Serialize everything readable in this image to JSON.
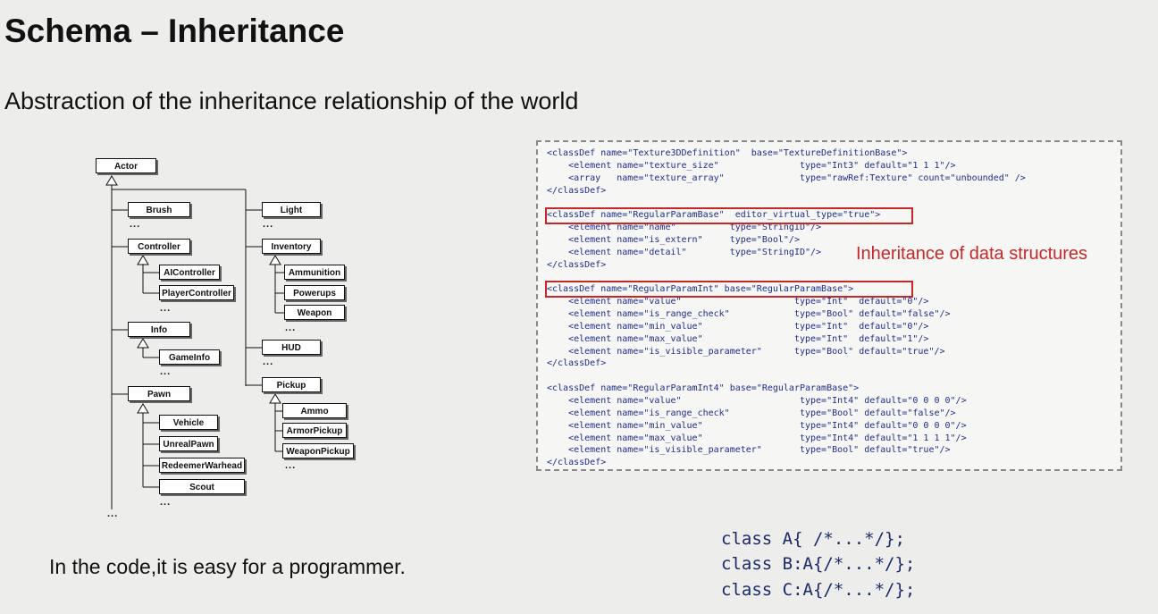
{
  "slide": {
    "title": "Schema – Inheritance",
    "subtitle": "Abstraction of the inheritance relationship of the world",
    "bottom_note": "In the code,it is easy for a programmer."
  },
  "tree": {
    "root": "Actor",
    "nodes": [
      "Brush",
      "Controller",
      "AIController",
      "PlayerController",
      "Info",
      "GameInfo",
      "Pawn",
      "Vehicle",
      "UnrealPawn",
      "RedeemerWarhead",
      "Scout",
      "Light",
      "Inventory",
      "Ammunition",
      "Powerups",
      "Weapon",
      "HUD",
      "Pickup",
      "Ammo",
      "ArmorPickup",
      "WeaponPickup"
    ],
    "ellipsis": "..."
  },
  "xml": {
    "annotation": "Inheritance of data structures",
    "lines": [
      "<classDef name=\"Texture3DDefinition\"  base=\"TextureDefinitionBase\">",
      "    <element name=\"texture_size\"               type=\"Int3\" default=\"1 1 1\"/>",
      "    <array   name=\"texture_array\"              type=\"rawRef:Texture\" count=\"unbounded\" />",
      "</classDef>",
      "",
      "<classDef name=\"RegularParamBase\"  editor_virtual_type=\"true\">",
      "    <element name=\"name\"          type=\"StringID\"/>",
      "    <element name=\"is_extern\"     type=\"Bool\"/>",
      "    <element name=\"detail\"        type=\"StringID\"/>",
      "</classDef>",
      "",
      "<classDef name=\"RegularParamInt\" base=\"RegularParamBase\">",
      "    <element name=\"value\"                     type=\"Int\"  default=\"0\"/>",
      "    <element name=\"is_range_check\"            type=\"Bool\" default=\"false\"/>",
      "    <element name=\"min_value\"                 type=\"Int\"  default=\"0\"/>",
      "    <element name=\"max_value\"                 type=\"Int\"  default=\"1\"/>",
      "    <element name=\"is_visible_parameter\"      type=\"Bool\" default=\"true\"/>",
      "</classDef>",
      "",
      "<classDef name=\"RegularParamInt4\" base=\"RegularParamBase\">",
      "    <element name=\"value\"                      type=\"Int4\" default=\"0 0 0 0\"/>",
      "    <element name=\"is_range_check\"             type=\"Bool\" default=\"false\"/>",
      "    <element name=\"min_value\"                  type=\"Int4\" default=\"0 0 0 0\"/>",
      "    <element name=\"max_value\"                  type=\"Int4\" default=\"1 1 1 1\"/>",
      "    <element name=\"is_visible_parameter\"       type=\"Bool\" default=\"true\"/>",
      "</classDef>"
    ]
  },
  "code": {
    "lines": [
      "class A{ /*...*/};",
      "class B:A{/*...*/};",
      "class C:A{/*...*/};"
    ]
  },
  "colors": {
    "highlight": "#c62828",
    "code": "#1b2a6b",
    "comment": "#2e7d32"
  }
}
